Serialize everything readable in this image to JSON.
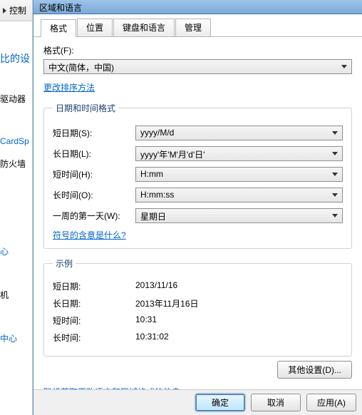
{
  "left": {
    "breadcrumb_frag": "控制",
    "heading_frag": "比的设",
    "items": [
      "驱动器",
      "CardSp",
      "防火墙",
      "心",
      "机",
      "中心"
    ]
  },
  "dialog": {
    "title": "区域和语言",
    "tabs": [
      "格式",
      "位置",
      "键盘和语言",
      "管理"
    ],
    "active_tab": 0,
    "format_label": "格式(F):",
    "format_value": "中文(简体，中国)",
    "sort_link": "更改排序方法",
    "dt_legend": "日期和时间格式",
    "dt": {
      "short_date_lab": "短日期(S):",
      "short_date_val": "yyyy/M/d",
      "long_date_lab": "长日期(L):",
      "long_date_val": "yyyy'年'M'月'd'日'",
      "short_time_lab": "短时间(H):",
      "short_time_val": "H:mm",
      "long_time_lab": "长时间(O):",
      "long_time_val": "H:mm:ss",
      "first_day_lab": "一周的第一天(W):",
      "first_day_val": "星期日",
      "notation_link": "符号的含意是什么?"
    },
    "example_legend": "示例",
    "example": {
      "short_date_lab": "短日期:",
      "short_date_val": "2013/11/16",
      "long_date_lab": "长日期:",
      "long_date_val": "2013年11月16日",
      "short_time_lab": "短时间:",
      "short_time_val": "10:31",
      "long_time_lab": "长时间:",
      "long_time_val": "10:31:02"
    },
    "additional_btn": "其他设置(D)...",
    "online_link": "联机获取更改语言和区域格式的信息",
    "ok_btn": "确定",
    "cancel_btn": "取消",
    "apply_btn": "应用(A)"
  }
}
